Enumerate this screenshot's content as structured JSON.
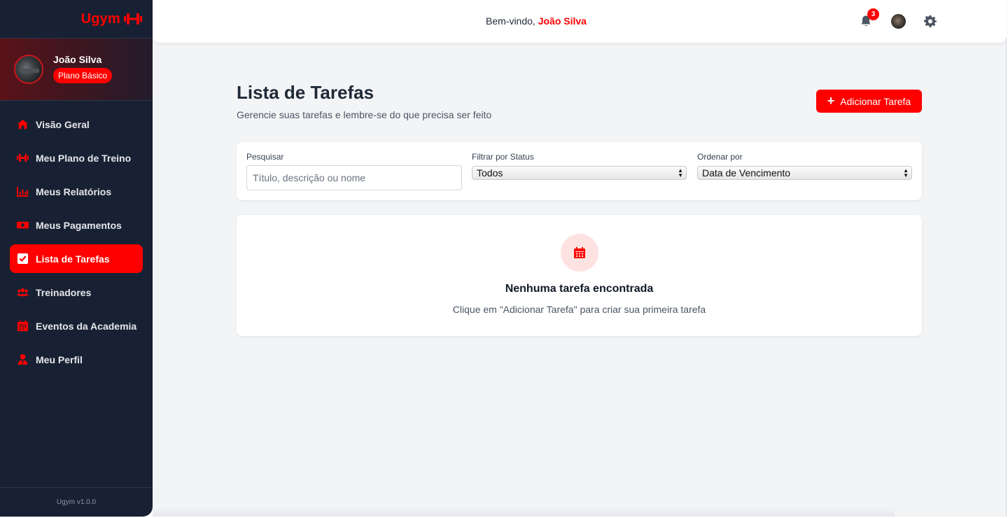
{
  "brand": {
    "name": "Ugym",
    "icon": "dumbbell-icon"
  },
  "user": {
    "name": "João Silva",
    "plan": "Plano Básico"
  },
  "nav": {
    "items": [
      {
        "label": "Visão Geral",
        "icon": "home-icon"
      },
      {
        "label": "Meu Plano de Treino",
        "icon": "dumbbell-icon"
      },
      {
        "label": "Meus Relatórios",
        "icon": "chart-icon"
      },
      {
        "label": "Meus Pagamentos",
        "icon": "money-icon"
      },
      {
        "label": "Lista de Tarefas",
        "icon": "checkbox-icon",
        "active": true
      },
      {
        "label": "Treinadores",
        "icon": "users-icon"
      },
      {
        "label": "Eventos da Academia",
        "icon": "calendar-icon"
      },
      {
        "label": "Meu Perfil",
        "icon": "user-tie-icon"
      }
    ]
  },
  "version": "Ugym v1.0.0",
  "topbar": {
    "welcome_prefix": "Bem-vindo,",
    "welcome_name": "João Silva",
    "notification_count": "3"
  },
  "page": {
    "title": "Lista de Tarefas",
    "subtitle": "Gerencie suas tarefas e lembre-se do que precisa ser feito",
    "add_button": "Adicionar Tarefa"
  },
  "filters": {
    "search_label": "Pesquisar",
    "search_placeholder": "Título, descrição ou nome",
    "status_label": "Filtrar por Status",
    "status_value": "Todos",
    "sort_label": "Ordenar por",
    "sort_value": "Data de Vencimento"
  },
  "empty": {
    "title": "Nenhuma tarefa encontrada",
    "subtitle": "Clique em \"Adicionar Tarefa\" para criar sua primeira tarefa"
  },
  "colors": {
    "accent": "#ff0000",
    "sidebar": "#182133",
    "background": "#f3f4f6"
  }
}
